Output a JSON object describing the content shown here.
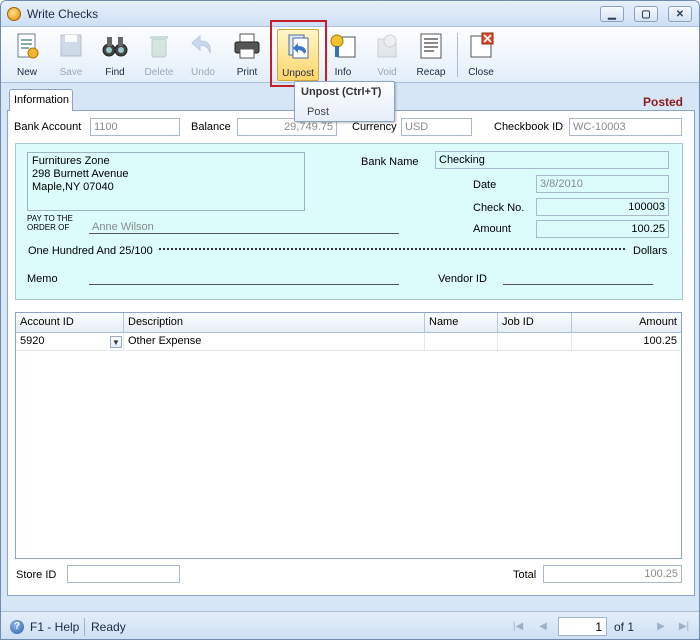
{
  "window": {
    "title": "Write Checks"
  },
  "toolbar": {
    "new": "New",
    "save": "Save",
    "find": "Find",
    "delete": "Delete",
    "undo": "Undo",
    "print": "Print",
    "unpost": "Unpost",
    "info": "Info",
    "void": "Void",
    "recap": "Recap",
    "close": "Close"
  },
  "tooltip": {
    "title": "Unpost (Ctrl+T)",
    "item": "Post"
  },
  "tab": {
    "label": "Information"
  },
  "status": "Posted",
  "header": {
    "bank_account_label": "Bank Account",
    "bank_account_value": "1100",
    "balance_label": "Balance",
    "balance_value": "29,749.75",
    "currency_label": "Currency",
    "currency_value": "USD",
    "checkbook_label": "Checkbook ID",
    "checkbook_value": "WC-10003"
  },
  "check": {
    "payee_line1": "Furnitures Zone",
    "payee_line2": "298 Burnett Avenue",
    "payee_line3": "Maple,NY 07040",
    "pay_to_line1": "PAY TO THE",
    "pay_to_line2": "ORDER OF",
    "pay_to_value": "Anne Wilson",
    "bank_name_label": "Bank Name",
    "bank_name_value": "Checking",
    "date_label": "Date",
    "date_value": "3/8/2010",
    "check_no_label": "Check No.",
    "check_no_value": "100003",
    "amount_label": "Amount",
    "amount_value": "100.25",
    "amount_words": "One Hundred  And 25/100",
    "dollars": "Dollars",
    "memo_label": "Memo",
    "vendor_label": "Vendor ID"
  },
  "grid": {
    "columns": [
      "Account ID",
      "Description",
      "Name",
      "Job ID",
      "Amount"
    ],
    "rows": [
      {
        "account": "5920",
        "description": "Other Expense",
        "name": "",
        "job": "",
        "amount": "100.25"
      }
    ]
  },
  "footer": {
    "store_label": "Store ID",
    "total_label": "Total",
    "total_value": "100.25"
  },
  "statusbar": {
    "help": "F1 - Help",
    "ready": "Ready",
    "page": "1",
    "of": "of 1"
  }
}
